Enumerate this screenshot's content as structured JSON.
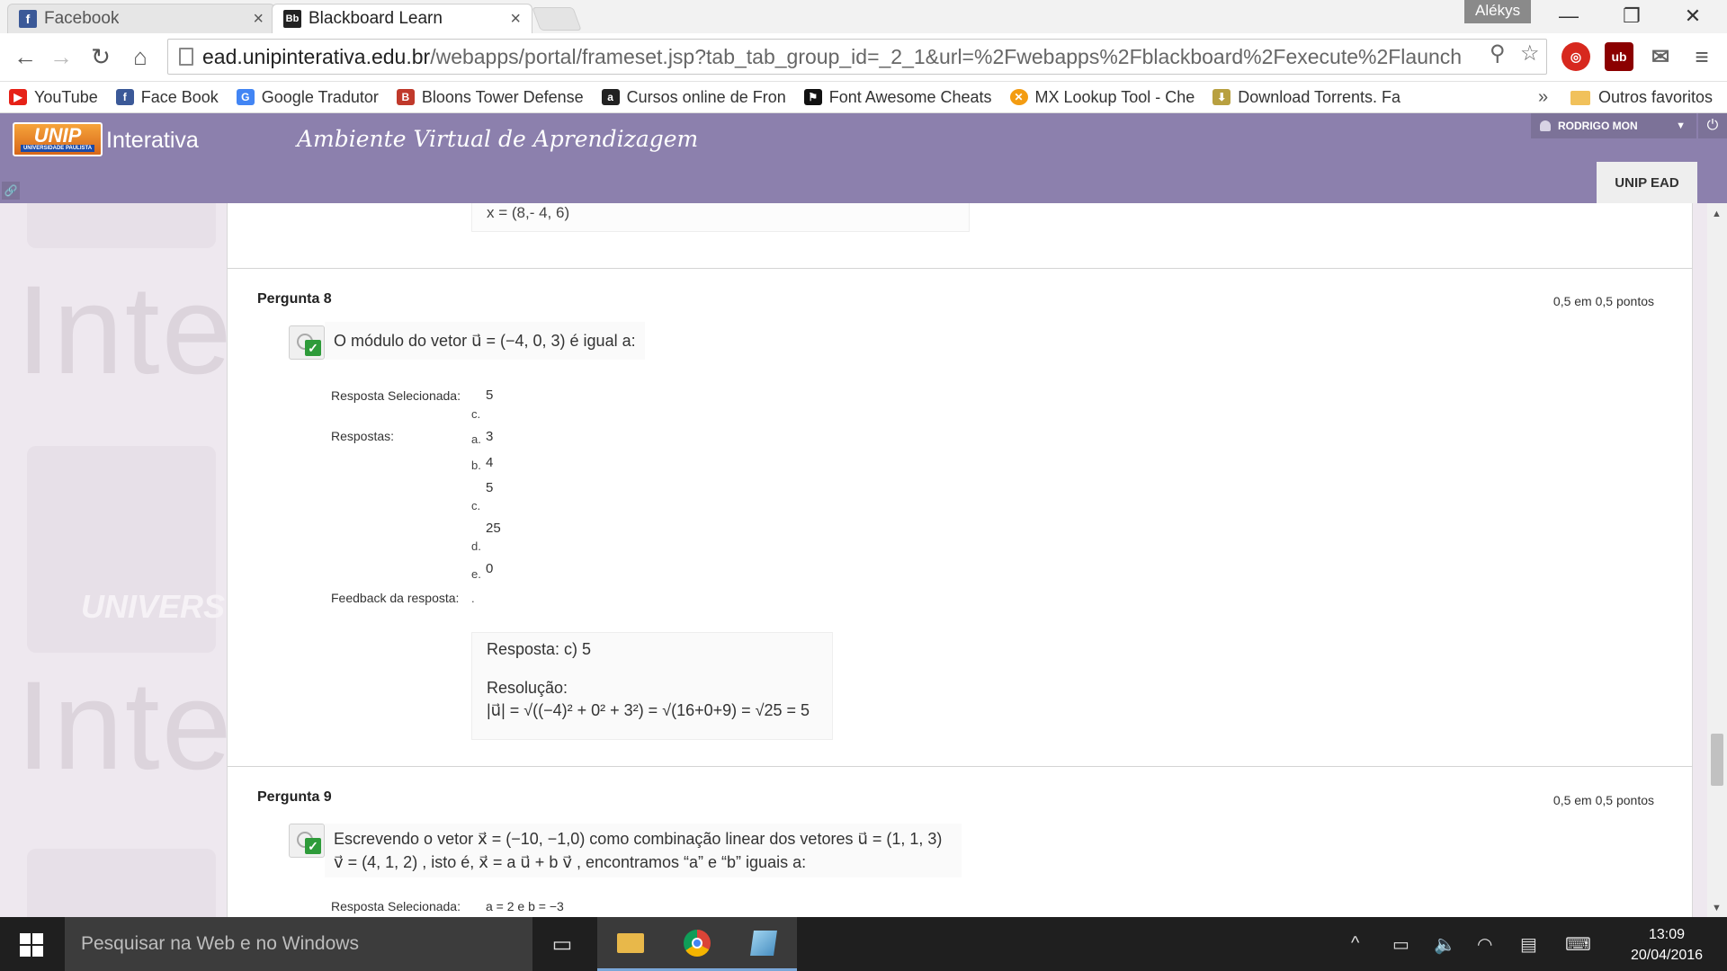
{
  "browser": {
    "tabs": [
      {
        "label": "Facebook",
        "favicon": "f",
        "active": false
      },
      {
        "label": "Blackboard Learn",
        "favicon": "Bb",
        "active": true
      }
    ],
    "profile_name": "Alékys",
    "url_host": "ead.unipinterativa.edu.br",
    "url_path": "/webapps/portal/frameset.jsp?tab_tab_group_id=_2_1&url=%2Fwebapps%2Fblackboard%2Fexecute%2Flaunch"
  },
  "bookmarks": [
    {
      "label": "YouTube",
      "icon": "youtube-icon",
      "color": "#e62117",
      "glyph": "▶"
    },
    {
      "label": "Face Book",
      "icon": "facebook-icon",
      "color": "#3b5998",
      "glyph": "f"
    },
    {
      "label": "Google Tradutor",
      "icon": "google-translate-icon",
      "color": "#4285f4",
      "glyph": "G"
    },
    {
      "label": "Bloons Tower Defense",
      "icon": "bloons-icon",
      "color": "#c0392b",
      "glyph": "B"
    },
    {
      "label": "Cursos online de Fron",
      "icon": "course-icon",
      "color": "#222222",
      "glyph": "a"
    },
    {
      "label": "Font Awesome Cheats",
      "icon": "flag-icon",
      "color": "#111111",
      "glyph": "⚑"
    },
    {
      "label": "MX Lookup Tool - Che",
      "icon": "mx-icon",
      "color": "#f39c12",
      "glyph": "✕"
    },
    {
      "label": "Download Torrents. Fa",
      "icon": "torrent-icon",
      "color": "#b8a040",
      "glyph": "⬇"
    }
  ],
  "bookmarks_other": "Outros favoritos",
  "header": {
    "logo_text": "UNIP",
    "logo_sub": "UNIVERSIDADE PAULISTA",
    "brand": "Interativa",
    "tagline": "Ambiente Virtual de Aprendizagem",
    "user": "RODRIGO MON",
    "tab": "UNIP EAD"
  },
  "watermark": {
    "text": "Inte",
    "card_text": "UNIVERS"
  },
  "previous_fragment": "x = (8,- 4, 6)",
  "questions": [
    {
      "title": "Pergunta 8",
      "points": "0,5 em 0,5 pontos",
      "text": "O módulo do vetor  u⃗ = (−4,  0,  3)  é igual a:",
      "selected_label": "Resposta Selecionada:",
      "selected_letter": "c.",
      "selected_value": "5",
      "answers_label": "Respostas:",
      "answers": [
        {
          "letter": "a.",
          "value": "3"
        },
        {
          "letter": "b.",
          "value": "4"
        },
        {
          "letter": "c.",
          "value": "5"
        },
        {
          "letter": "d.",
          "value": "25"
        },
        {
          "letter": "e.",
          "value": "0"
        }
      ],
      "feedback_label": "Feedback da resposta:",
      "feedback_dot": ".",
      "feedback_answer": "Resposta: c) 5",
      "feedback_resolution": "Resolução:",
      "feedback_math": "|u⃗| = √((−4)² + 0² + 3²) = √(16+0+9) = √25 = 5"
    },
    {
      "title": "Pergunta 9",
      "points": "0,5 em 0,5 pontos",
      "text_line1": "Escrevendo o vetor x⃗ = (−10,  −1,0)  como combinação linear dos vetores  u⃗ = (1,  1,  3)",
      "text_line2": "v⃗ = (4,  1,  2) , isto é,   x⃗ = a u⃗ + b v⃗ , encontramos “a” e “b” iguais a:",
      "selected_label": "Resposta Selecionada:",
      "selected_value": "a = 2 e b = −3"
    }
  ],
  "taskbar": {
    "search_placeholder": "Pesquisar na Web e no Windows",
    "time": "13:09",
    "date": "20/04/2016"
  }
}
